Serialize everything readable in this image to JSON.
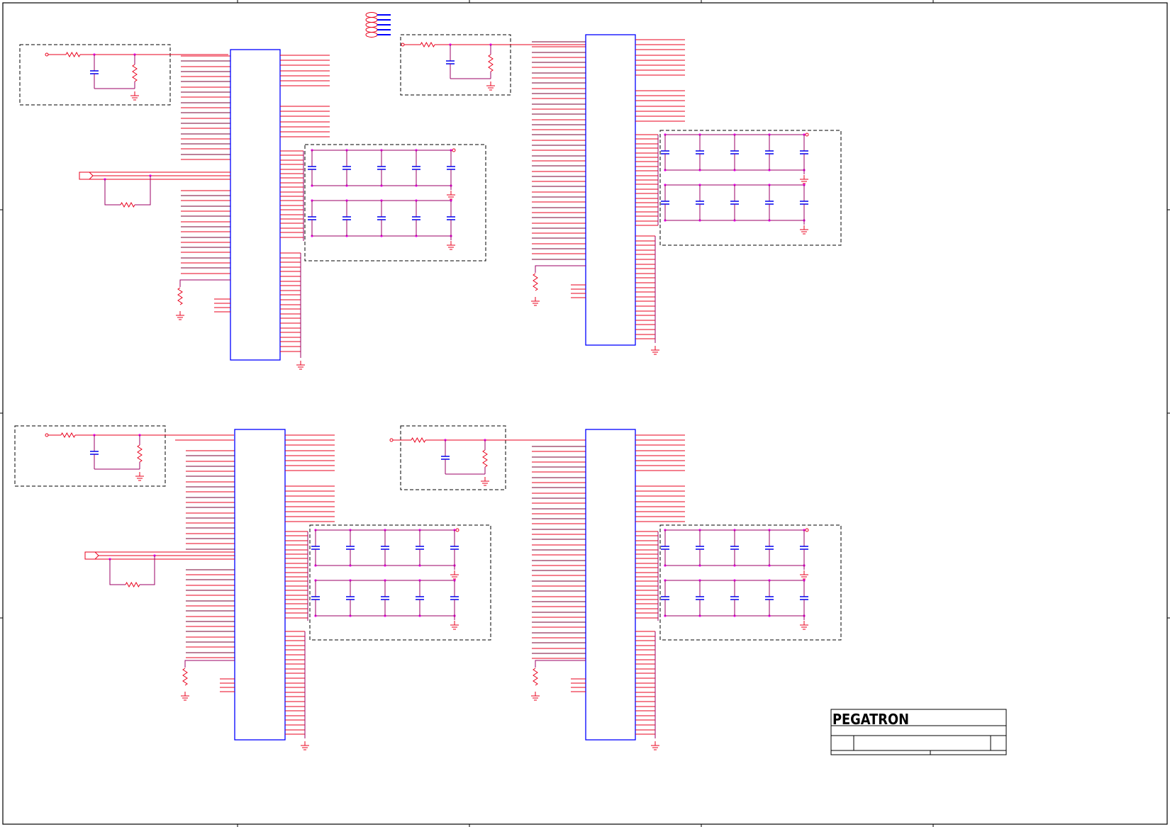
{
  "title_block": {
    "company": "PEGATRON"
  },
  "colors": {
    "wire": "#e8001c",
    "bus": "#7a0030",
    "chip": "#0000ff",
    "cap": "#0000ee",
    "net": "#9b0066",
    "junction": "#e600e6",
    "dash": "#000000",
    "frame": "#000000"
  },
  "quadrants": [
    {
      "id": "top-left"
    },
    {
      "id": "top-right"
    },
    {
      "id": "bottom-left"
    },
    {
      "id": "bottom-right"
    }
  ]
}
